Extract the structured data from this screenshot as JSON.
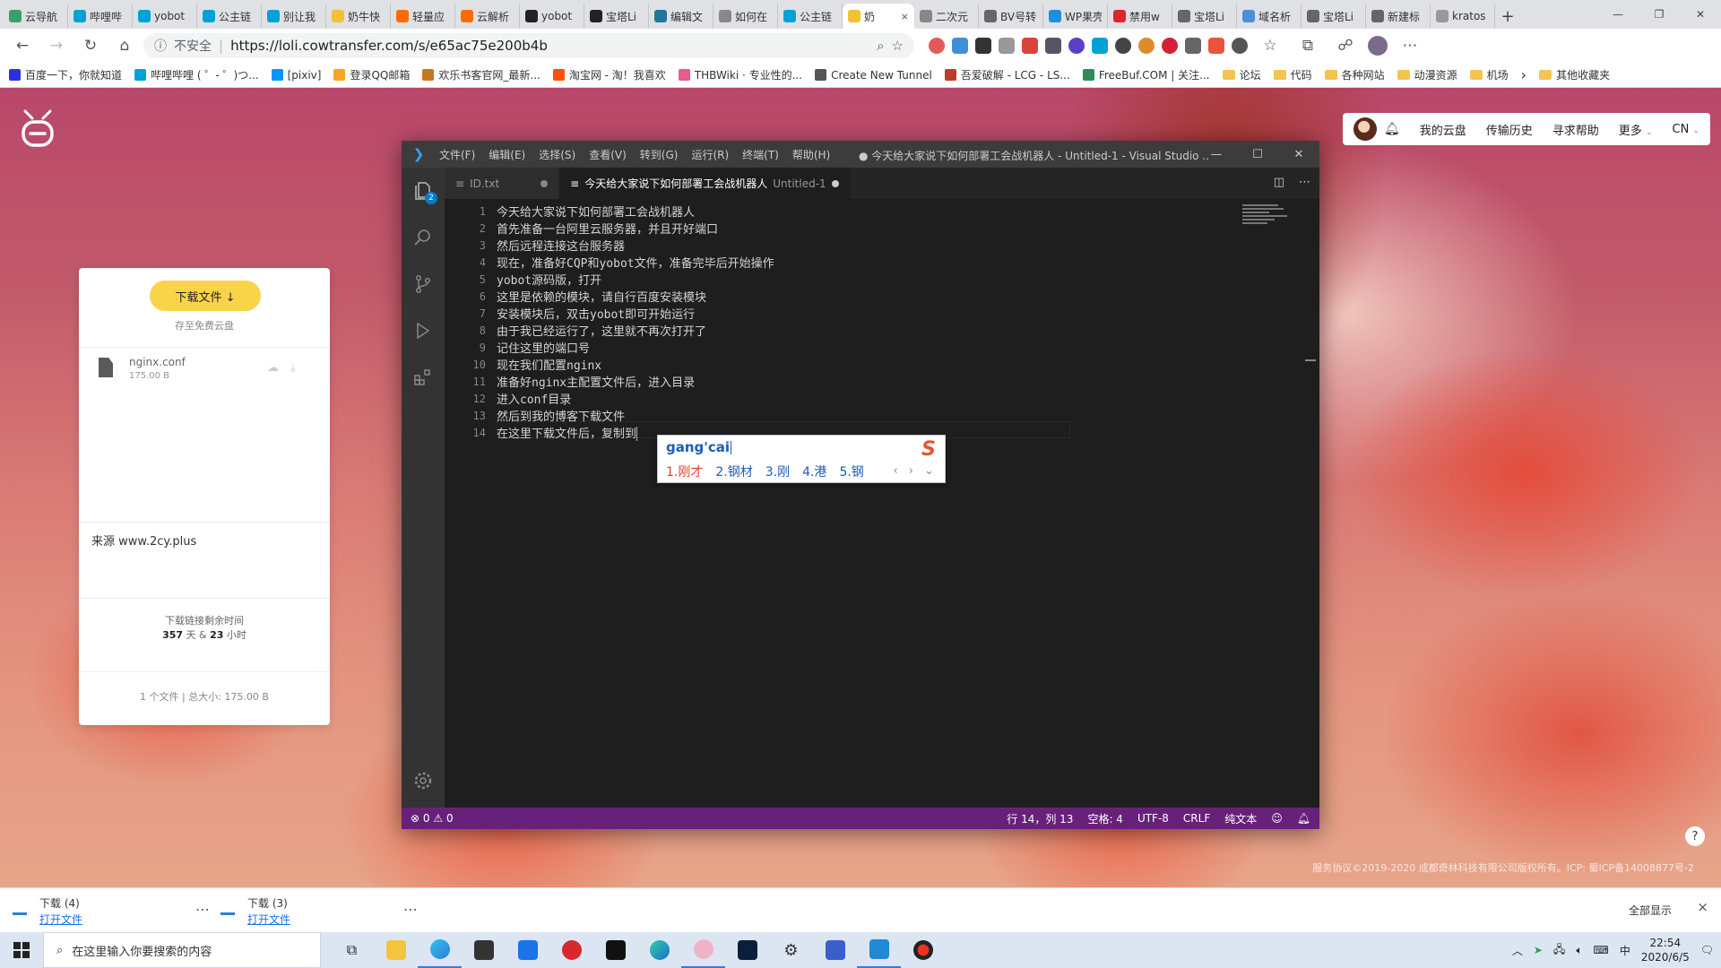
{
  "browser": {
    "tabs": [
      {
        "title": "云导航",
        "color": "#38a169"
      },
      {
        "title": "哔哩哔",
        "color": "#00a1d6"
      },
      {
        "title": "yobot",
        "color": "#00a1d6"
      },
      {
        "title": "公主链",
        "color": "#00a1d6"
      },
      {
        "title": "别让我",
        "color": "#00a1d6"
      },
      {
        "title": "奶牛快",
        "color": "#f2c230"
      },
      {
        "title": "轻量应",
        "color": "#ff6a00"
      },
      {
        "title": "云解析",
        "color": "#ff6a00"
      },
      {
        "title": "yobot",
        "color": "#222222"
      },
      {
        "title": "宝塔Li",
        "color": "#222222"
      },
      {
        "title": "编辑文",
        "color": "#21759b"
      },
      {
        "title": "如何在",
        "color": "#888888"
      },
      {
        "title": "公主链",
        "color": "#00a1d6"
      },
      {
        "title": "奶",
        "color": "#f2c230",
        "active": true
      },
      {
        "title": "二次元",
        "color": "#888888"
      },
      {
        "title": "BV号转",
        "color": "#666666"
      },
      {
        "title": "WP果壳",
        "color": "#1d8fe1"
      },
      {
        "title": "禁用w",
        "color": "#d9272e"
      },
      {
        "title": "宝塔Li",
        "color": "#666666"
      },
      {
        "title": "域名析",
        "color": "#4a90d9"
      },
      {
        "title": "宝塔Li",
        "color": "#666666"
      },
      {
        "title": "新建标",
        "color": "#666666"
      },
      {
        "title": "kratos",
        "color": "#999999"
      }
    ],
    "active_tab_close": "×",
    "new_tab": "+",
    "security_label": "不安全",
    "url": "https://loli.cowtransfer.com/s/e65ac75e200b4b",
    "bookmarks": [
      {
        "label": "百度一下，你就知道",
        "type": "site",
        "color": "#2932e1"
      },
      {
        "label": "哔哩哔哩 ( ゜- ゜)つ...",
        "type": "site",
        "color": "#00a1d6"
      },
      {
        "label": "[pixiv]",
        "type": "site",
        "color": "#0096fa"
      },
      {
        "label": "登录QQ邮箱",
        "type": "site",
        "color": "#f5a623"
      },
      {
        "label": "欢乐书客官网_最新...",
        "type": "site",
        "color": "#c47a1c"
      },
      {
        "label": "淘宝网 - 淘！我喜欢",
        "type": "site",
        "color": "#ff5000"
      },
      {
        "label": "THBWiki · 专业性的...",
        "type": "site",
        "color": "#e85b8a"
      },
      {
        "label": "Create New Tunnel",
        "type": "site",
        "color": "#555555"
      },
      {
        "label": "吾爱破解 - LCG - LS...",
        "type": "site",
        "color": "#c0392b"
      },
      {
        "label": "FreeBuf.COM | 关注...",
        "type": "site",
        "color": "#2e8b57"
      },
      {
        "label": "论坛",
        "type": "folder"
      },
      {
        "label": "代码",
        "type": "folder"
      },
      {
        "label": "各种网站",
        "type": "folder"
      },
      {
        "label": "动漫资源",
        "type": "folder"
      },
      {
        "label": "机场",
        "type": "folder"
      },
      {
        "label": "其他收藏夹",
        "type": "folder"
      }
    ]
  },
  "cowtransfer": {
    "nav": {
      "my_cloud": "我的云盘",
      "history": "传输历史",
      "help": "寻求帮助",
      "more": "更多",
      "lang": "CN"
    },
    "download_button": "下载文件 ↓",
    "save_free": "存至免费云盘",
    "file": {
      "name": "nginx.conf",
      "size": "175.00 B"
    },
    "source": "来源 www.2cy.plus",
    "expire_label": "下载链接剩余时间",
    "expire_days": "357",
    "expire_days_unit": "天 &",
    "expire_hours": "23",
    "expire_hours_unit": "小时",
    "totals": "1 个文件 | 总大小: 175.00 B",
    "footer": "服务协议©2019-2020 成都奇林科技有限公司版权所有。ICP: 蜀ICP备14008877号-2",
    "help": "?"
  },
  "vscode": {
    "menu": [
      "文件(F)",
      "编辑(E)",
      "选择(S)",
      "查看(V)",
      "转到(G)",
      "运行(R)",
      "终端(T)",
      "帮助(H)"
    ],
    "window_title": "● 今天给大家说下如何部署工会战机器人 - Untitled-1 - Visual Studio ...",
    "explorer_badge": "2",
    "tabs": [
      {
        "label": "ID.txt",
        "extra": ""
      },
      {
        "label": "今天给大家说下如何部署工会战机器人",
        "extra": "Untitled-1"
      }
    ],
    "lines": [
      "今天给大家说下如何部署工会战机器人",
      "首先准备一台阿里云服务器，并且开好端口",
      "然后远程连接这台服务器",
      "现在，准备好CQP和yobot文件，准备完毕后开始操作",
      "yobot源码版，打开",
      "这里是依赖的模块，请自行百度安装模块",
      "安装模块后，双击yobot即可开始运行",
      "由于我已经运行了，这里就不再次打开了",
      "记住这里的端口号",
      "现在我们配置nginx",
      "准备好nginx主配置文件后，进入目录",
      "进入conf目录",
      "然后到我的博客下载文件",
      "在这里下载文件后，复制到"
    ],
    "status": {
      "errors": "0",
      "warnings": "0",
      "position": "行 14，列 13",
      "spaces": "空格: 4",
      "encoding": "UTF-8",
      "eol": "CRLF",
      "language": "纯文本"
    }
  },
  "ime": {
    "composition": "gang'cai",
    "candidates": [
      "1.刚才",
      "2.钢材",
      "3.刚",
      "4.港",
      "5.钢"
    ],
    "pager": "‹ › ⌄"
  },
  "downloads": {
    "items": [
      {
        "name": "下载 (4)",
        "action": "打开文件"
      },
      {
        "name": "下载 (3)",
        "action": "打开文件"
      }
    ],
    "show_all": "全部显示",
    "close": "×"
  },
  "taskbar": {
    "search_placeholder": "在这里输入你要搜索的内容",
    "time": "22:54",
    "date": "2020/6/5",
    "ime_indicator": "中"
  }
}
